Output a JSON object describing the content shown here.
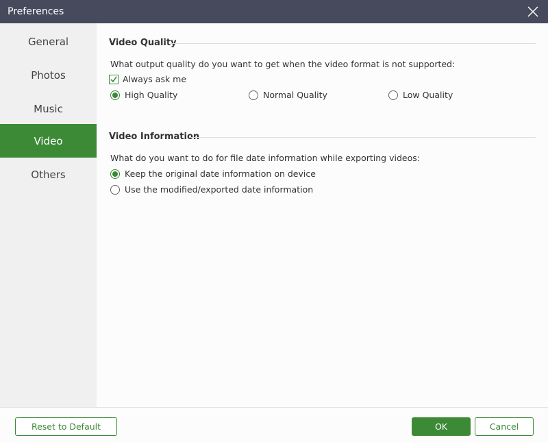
{
  "window": {
    "title": "Preferences",
    "close_icon": "close-icon"
  },
  "colors": {
    "accent": "#3d8a36",
    "titlebar": "#474a5c",
    "sidebar_bg": "#f0f0f0"
  },
  "sidebar": {
    "items": [
      {
        "label": "General",
        "active": false
      },
      {
        "label": "Photos",
        "active": false
      },
      {
        "label": "Music",
        "active": false
      },
      {
        "label": "Video",
        "active": true
      },
      {
        "label": "Others",
        "active": false
      }
    ]
  },
  "video_quality": {
    "title": "Video Quality",
    "question": "What output quality do you want to get when the video format is not supported:",
    "always_ask": {
      "label": "Always ask me",
      "checked": true
    },
    "options": [
      {
        "label": "High Quality",
        "checked": true
      },
      {
        "label": "Normal Quality",
        "checked": false
      },
      {
        "label": "Low Quality",
        "checked": false
      }
    ]
  },
  "video_information": {
    "title": "Video Information",
    "question": "What do you want to do for file date information while exporting videos:",
    "options": [
      {
        "label": "Keep the original date information on device",
        "checked": true
      },
      {
        "label": "Use the modified/exported date information",
        "checked": false
      }
    ]
  },
  "footer": {
    "reset_label": "Reset to Default",
    "ok_label": "OK",
    "cancel_label": "Cancel"
  }
}
